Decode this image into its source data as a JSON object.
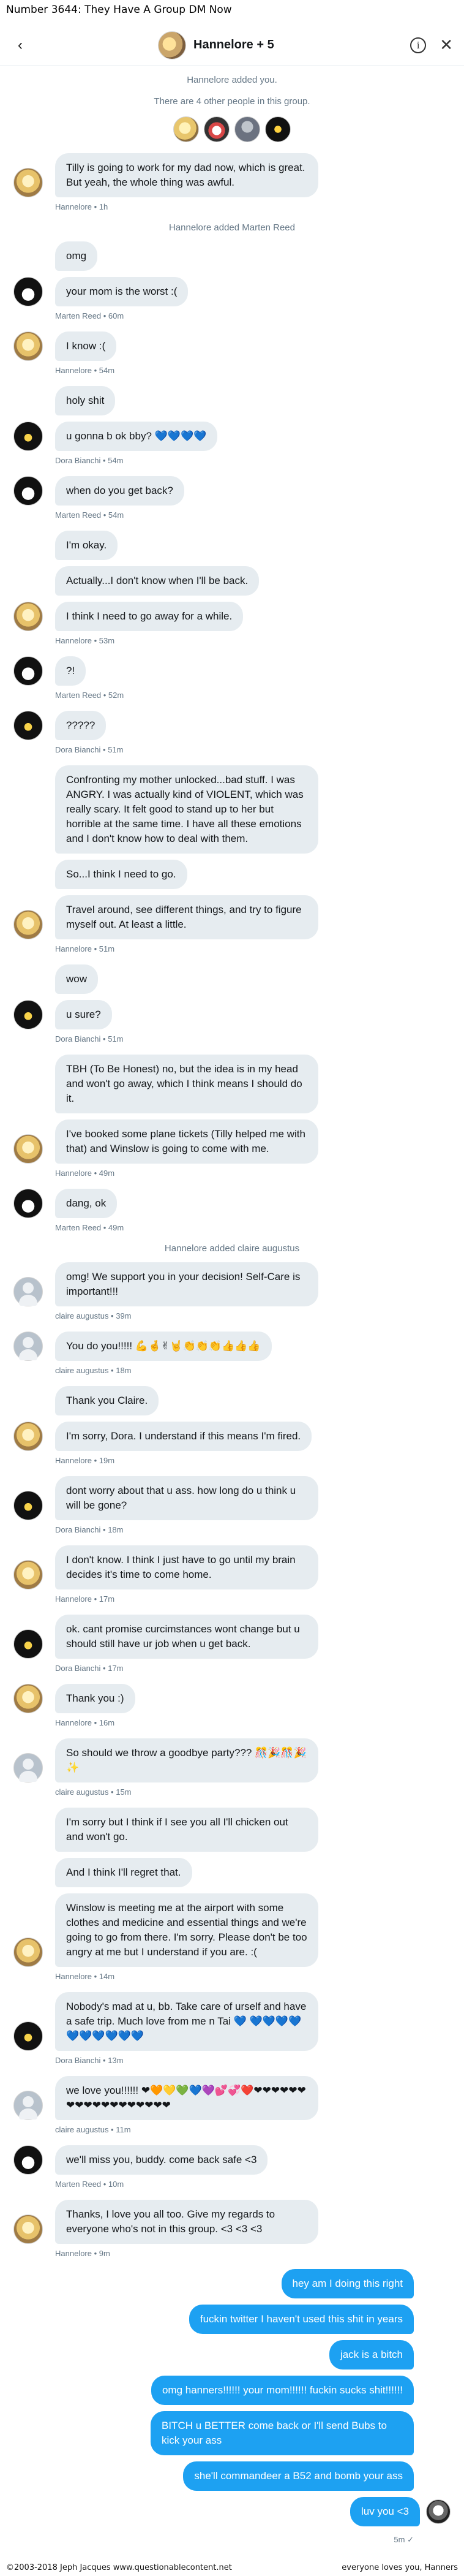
{
  "comic_title": "Number 3644: They Have A Group DM Now",
  "header": {
    "group_name": "Hannelore + 5",
    "back_icon": "chevron-left-icon",
    "info_icon": "info-icon",
    "close_icon": "close-icon"
  },
  "system": {
    "added_you": "Hannelore added you.",
    "others": "There are 4 other people in this group."
  },
  "messages": [
    {
      "side": "in",
      "avatar": "h",
      "bubbles": [
        "Tilly is going to work for my dad now, which is great. But yeah, the whole thing was awful."
      ],
      "meta": "Hannelore • 1h"
    },
    {
      "side": "sys",
      "text": "Hannelore added Marten Reed"
    },
    {
      "side": "in",
      "avatar": "mr",
      "bubbles": [
        "omg",
        "your mom is the worst :("
      ],
      "meta": "Marten Reed • 60m"
    },
    {
      "side": "in",
      "avatar": "h",
      "bubbles": [
        "I know :("
      ],
      "meta": "Hannelore • 54m"
    },
    {
      "side": "in",
      "avatar": "db",
      "bubbles": [
        "holy shit",
        "u gonna b ok bby? 💙💙💙💙"
      ],
      "meta": "Dora Bianchi • 54m"
    },
    {
      "side": "in",
      "avatar": "mr",
      "bubbles": [
        "when do you get back?"
      ],
      "meta": "Marten Reed • 54m"
    },
    {
      "side": "in",
      "avatar": "h",
      "bubbles": [
        "I'm okay.",
        "Actually...I don't know when I'll be back.",
        "I think I need to go away for a while."
      ],
      "meta": "Hannelore • 53m"
    },
    {
      "side": "in",
      "avatar": "mr",
      "bubbles": [
        "?!"
      ],
      "meta": "Marten Reed • 52m"
    },
    {
      "side": "in",
      "avatar": "db",
      "bubbles": [
        "?????"
      ],
      "meta": "Dora Bianchi • 51m"
    },
    {
      "side": "in",
      "avatar": "h",
      "bubbles": [
        "Confronting my mother unlocked...bad stuff. I was ANGRY. I was actually kind of VIOLENT, which was really scary. It felt good to stand up to her but horrible at the same time. I have all these emotions and I don't know how to deal with them.",
        "So...I think I need to go.",
        "Travel around, see different things, and try to figure myself out. At least a little."
      ],
      "meta": "Hannelore • 51m"
    },
    {
      "side": "in",
      "avatar": "db",
      "bubbles": [
        "wow",
        "u sure?"
      ],
      "meta": "Dora Bianchi • 51m"
    },
    {
      "side": "in",
      "avatar": "h",
      "bubbles": [
        "TBH (To Be Honest) no, but the idea is in my head and won't go away, which I think means I should do it.",
        "I've booked some plane tickets (Tilly helped me with that) and Winslow is going to come with me."
      ],
      "meta": "Hannelore • 49m"
    },
    {
      "side": "in",
      "avatar": "mr",
      "bubbles": [
        "dang, ok"
      ],
      "meta": "Marten Reed • 49m"
    },
    {
      "side": "sys",
      "text": "Hannelore added claire augustus"
    },
    {
      "side": "in",
      "avatar": "ca",
      "bubbles": [
        "omg! We support you in your decision! Self-Care is important!!!"
      ],
      "meta": "claire augustus • 39m"
    },
    {
      "side": "in",
      "avatar": "ca",
      "bubbles": [
        "You do you!!!!! 💪🤞✌🤘👏👏👏👍👍👍"
      ],
      "meta": "claire augustus • 18m"
    },
    {
      "side": "in",
      "avatar": "h",
      "bubbles": [
        "Thank you Claire.",
        "I'm sorry, Dora. I understand if this means I'm fired."
      ],
      "meta": "Hannelore • 19m"
    },
    {
      "side": "in",
      "avatar": "db",
      "bubbles": [
        "dont worry about that u ass. how long do u think u will be gone?"
      ],
      "meta": "Dora Bianchi • 18m"
    },
    {
      "side": "in",
      "avatar": "h",
      "bubbles": [
        "I don't know. I think I just have to go until my brain decides it's time to come home."
      ],
      "meta": "Hannelore • 17m"
    },
    {
      "side": "in",
      "avatar": "db",
      "bubbles": [
        "ok. cant promise curcimstances wont change but u should still have ur job when u get back."
      ],
      "meta": "Dora Bianchi • 17m"
    },
    {
      "side": "in",
      "avatar": "h",
      "bubbles": [
        "Thank you :)"
      ],
      "meta": "Hannelore • 16m"
    },
    {
      "side": "in",
      "avatar": "ca",
      "bubbles": [
        "So should we throw a goodbye party??? 🎊🎉🎊🎉✨"
      ],
      "meta": "claire augustus • 15m"
    },
    {
      "side": "in",
      "avatar": "h",
      "bubbles": [
        "I'm sorry but I think if I see you all I'll chicken out and won't go.",
        "And I think I'll regret that.",
        "Winslow is meeting me at the airport with some clothes and medicine and essential things and we're going to go from there. I'm sorry. Please don't be too angry at me but I understand if you are. :("
      ],
      "meta": "Hannelore • 14m"
    },
    {
      "side": "in",
      "avatar": "db",
      "bubbles": [
        "Nobody's mad at u, bb. Take care of urself and have a safe trip. Much love from me n Tai 💙 💙💙💙💙💙💙💙💙💙💙"
      ],
      "meta": "Dora Bianchi • 13m"
    },
    {
      "side": "in",
      "avatar": "ca",
      "bubbles": [
        "we love you!!!!!! ❤🧡💛💚💙💜💕💞❤️❤❤❤❤❤❤❤❤❤❤❤❤❤❤❤❤❤❤"
      ],
      "meta": "claire augustus • 11m"
    },
    {
      "side": "in",
      "avatar": "mr",
      "bubbles": [
        "we'll miss you, buddy. come back safe <3"
      ],
      "meta": "Marten Reed • 10m"
    },
    {
      "side": "in",
      "avatar": "h",
      "bubbles": [
        "Thanks, I love you all too. Give my regards to everyone who's not in this group. <3 <3 <3"
      ],
      "meta": "Hannelore • 9m"
    }
  ],
  "outgoing": [
    "hey am I doing this right",
    "fuckin twitter I haven't used this shit in years",
    "jack is a bitch",
    "omg hanners!!!!!! your mom!!!!!! fuckin sucks shit!!!!!!",
    "BITCH u BETTER come back or I'll send Bubs to kick your ass",
    "she'll commandeer a B52 and bomb your ass",
    "luv you <3"
  ],
  "seen": "5m",
  "footer": {
    "left": "©2003-2018 Jeph Jacques www.questionablecontent.net",
    "right": "everyone loves you, Hanners"
  }
}
